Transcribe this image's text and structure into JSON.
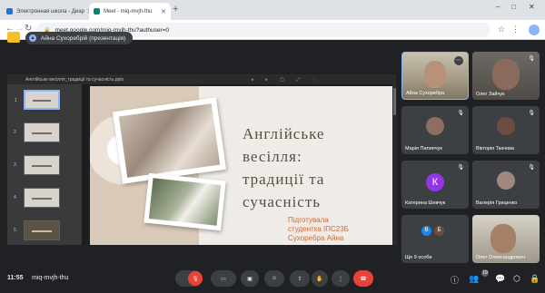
{
  "browser": {
    "tabs": [
      {
        "label": "Электронная школа - Диар",
        "fav_color": "#1a73e8"
      },
      {
        "label": "Meet - miq-mvjh-thu",
        "fav_color": "#00897b"
      }
    ],
    "new_tab": "+",
    "address": "meet.google.com/miq-mvjh-thu?authuser=0",
    "window_controls": [
      "–",
      "□",
      "✕"
    ]
  },
  "meet": {
    "share_text": "Айна Сухоребрій (презентація)",
    "presentation": {
      "file_name": "Англійське весілля_традиції та сучасність.pptx",
      "thumb_numbers": [
        "1",
        "2",
        "3",
        "4",
        "5"
      ],
      "slide_title": "Англійське\nвесілля:\nтрадиції та\nсучасність",
      "slide_subtitle": "Підготувала\nстудентка ІПС23Б\nСухоребра Айна"
    },
    "participants": [
      {
        "name": "Айна Сухоребра",
        "kind": "video1"
      },
      {
        "name": "Олег Зайчук",
        "kind": "video2"
      },
      {
        "name": "Марія Пилипчук",
        "kind": "avatar",
        "color": "#8d6e63"
      },
      {
        "name": "Вікторія Ткачова",
        "kind": "avatar",
        "color": "#6d4c41"
      },
      {
        "name": "Катерина Шевчук",
        "kind": "letter",
        "letter": "К"
      },
      {
        "name": "Валерія Гриценко",
        "kind": "avatar",
        "color": "#a1887f"
      },
      {
        "name": "Ще 9 особи",
        "kind": "more"
      },
      {
        "name": "Олег Олександрович",
        "kind": "video3"
      }
    ],
    "bottom": {
      "time": "11:55",
      "meeting_code": "miq-mvjh-thu",
      "badge_count": "19"
    }
  }
}
